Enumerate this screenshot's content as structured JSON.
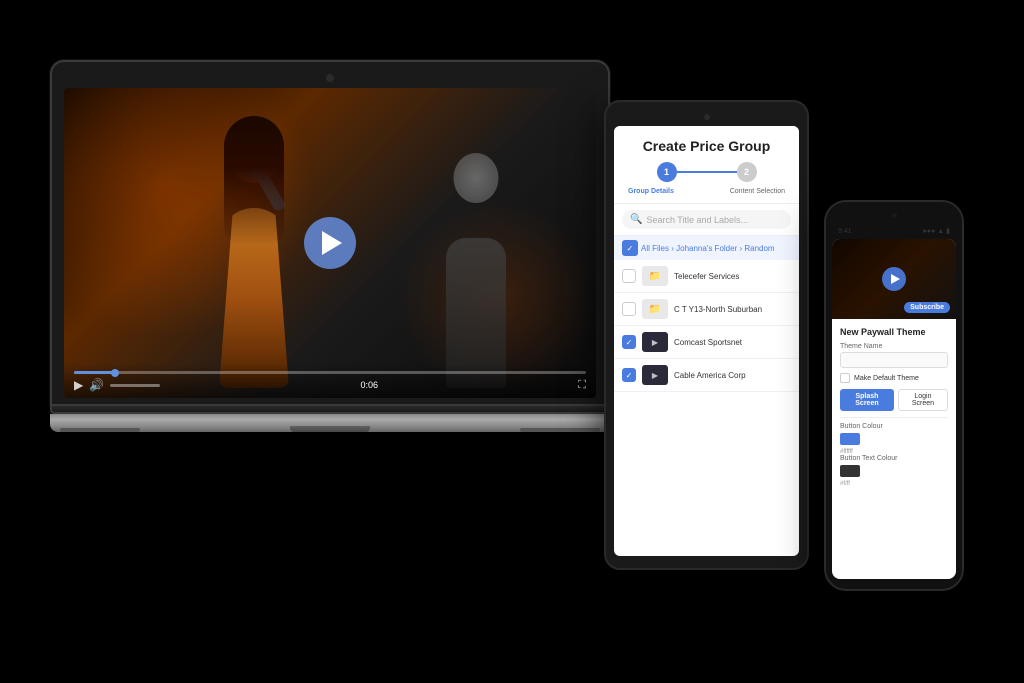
{
  "scene": {
    "background": "#000000"
  },
  "laptop": {
    "video": {
      "play_button_label": "▶",
      "time_display": "0:06",
      "progress_percent": 8
    }
  },
  "tablet": {
    "title": "Create Price Group",
    "steps": [
      {
        "label": "Group Details",
        "state": "active",
        "number": "1"
      },
      {
        "label": "Content Selection",
        "state": "inactive",
        "number": "2"
      }
    ],
    "search_placeholder": "Search Title and Labels...",
    "breadcrumb": "All Files › Johanna's Folder › Random",
    "files": [
      {
        "name": "Telecefer Services",
        "type": "folder",
        "checked": false
      },
      {
        "name": "C T Y13-North Suburban",
        "type": "folder",
        "checked": false
      },
      {
        "name": "Comcast Sportsnet",
        "type": "video",
        "checked": true
      },
      {
        "name": "Cable America Corp",
        "type": "video",
        "checked": true
      }
    ]
  },
  "phone": {
    "status_bar": {
      "time": "9:41",
      "signal": "●●●",
      "wifi": "▲",
      "battery": "■"
    },
    "paywall_form": {
      "title": "New Paywall Theme",
      "theme_name_label": "Theme Name",
      "make_default_label": "Make Default Theme",
      "btn_splash": "Splash Screen",
      "btn_login": "Login Screen",
      "button_colour_label": "Button Colour",
      "button_colour_value": "#ffffff",
      "text_colour_label": "Button Text Colour",
      "text_colour_value": "#f/ff"
    }
  }
}
